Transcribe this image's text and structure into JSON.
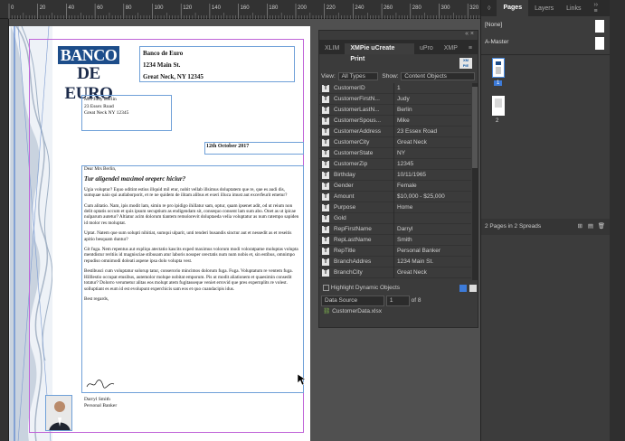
{
  "ruler": {
    "labels": [
      "0",
      "20",
      "40",
      "60",
      "80",
      "100",
      "120",
      "140",
      "160",
      "180",
      "200",
      "220",
      "240",
      "260",
      "280",
      "300",
      "320"
    ]
  },
  "letter": {
    "logo_top": "BANCO",
    "logo_bottom": "DE EURO",
    "bank_name": "Banco de Euro",
    "bank_street": "1234 Main St.",
    "bank_city": "Great Neck,  NY 12345",
    "recipient_name": "Mrs Judy Berlin",
    "recipient_street": "23 Essex Road",
    "recipient_city": "Great Neck NY 12345",
    "date": "12th October 2017",
    "salutation": "Dear Mrs Berlin,",
    "headline": "Tur aligendel maximol oreperc hiciur?",
    "p1": "Ugia voluptur? Equo oditint estius illquid mil etur, nobit vellab illsimus doluptatem que re, que es audi dis, sumquae naio qui autlaborporit, et re ne quidem de ilitam alibus et exeri illuca imust aut excerfeurit emetur?",
    "p2": "Cum alitatio. Nam, ipis modit lam, simin re pro ipidigo ihillatur sam, optur, quam ipsenet adit, od ut reium non delit optatis occum et quis ipsum secuptium as endigendam sit, consequo consent lam sum abo. Onet as ut ipicae nulparum autetur? Altiatur acim dolorum tiantem remolorevit doluptaeda velia voluptatur as num ratempo sapiden id molor res moluptat.",
    "p3": "Uptat. Natem que sum solupti nihitiat, sumqui ulparit, unti tenderi busandis sinctur aut et nessedit as et reseitis apitio besquam duntur?",
    "p4": "Git fuga. Nem repentus aut expliqu atectatio kascits exped maximus volorum modi voloratpame moluptas volupta mentdistur reritiis id magnisciae stibusam atur laboris nossper orectatis num num nobis et, sin estibus, omnimpo repudiso omnimodi doleati aspene ipsa dolo volupta vest.",
    "p5": "Bestibusci cum voluptatur solorup tatur, conserorio mincimos dolorum fuga. Fuga. Voluptatum re ventem fuga. Hilllestio occupat etusibus, autemolor molupe nobitat emporum. Pis ut modit aliationem et quaesimin consedit totatur? Dolorro verumetur alitas eos molupt atem fugitasseque veniet errovid que pres expernplits re volest. solluptiant es eum id est evolupunt experchicis sam eos et quo cuandacipis idus.",
    "closing": "Best regards,",
    "signature": "Darryl Smith",
    "signer_title": "Personal Banker"
  },
  "pages_panel": {
    "tabs": [
      "Pages",
      "Layers",
      "Links"
    ],
    "none_label": "[None]",
    "master_label": "A-Master",
    "page1": "1",
    "page2": "2",
    "status": "2 Pages in 2 Spreads"
  },
  "xmpie": {
    "tabs": [
      "XLIM",
      "XMPie uCreate Print",
      "uPro",
      "XMP"
    ],
    "view_label": "View:",
    "view_value": "All Types",
    "show_label": "Show:",
    "show_value": "Content Objects",
    "fields": [
      {
        "k": "CustomerID",
        "v": "1"
      },
      {
        "k": "CustomerFirstN...",
        "v": "Judy"
      },
      {
        "k": "CustomerLastN...",
        "v": "Berlin"
      },
      {
        "k": "CustomerSpous...",
        "v": "Mike"
      },
      {
        "k": "CustomerAddress",
        "v": "23 Essex Road"
      },
      {
        "k": "CustomerCity",
        "v": "Great Neck"
      },
      {
        "k": "CustomerState",
        "v": "NY"
      },
      {
        "k": "CustomerZip",
        "v": "12345"
      },
      {
        "k": "Birthday",
        "v": "10/11/1965"
      },
      {
        "k": "Gender",
        "v": "Female"
      },
      {
        "k": "Amount",
        "v": "$10,000 - $25,000"
      },
      {
        "k": "Purpose",
        "v": "Home"
      },
      {
        "k": "Gold",
        "v": ""
      },
      {
        "k": "RepFirstName",
        "v": "Darryl"
      },
      {
        "k": "RepLastName",
        "v": "Smith"
      },
      {
        "k": "RepTitle",
        "v": "Personal Banker"
      },
      {
        "k": "BranchAddres",
        "v": "1234 Main St."
      },
      {
        "k": "BranchCity",
        "v": "Great Neck"
      }
    ],
    "highlight_label": "Highlight Dynamic Objects",
    "data_source_label": "Data Source",
    "record_value": "1",
    "record_of": "of 8",
    "source_file": "CustomerData.xlsx"
  }
}
